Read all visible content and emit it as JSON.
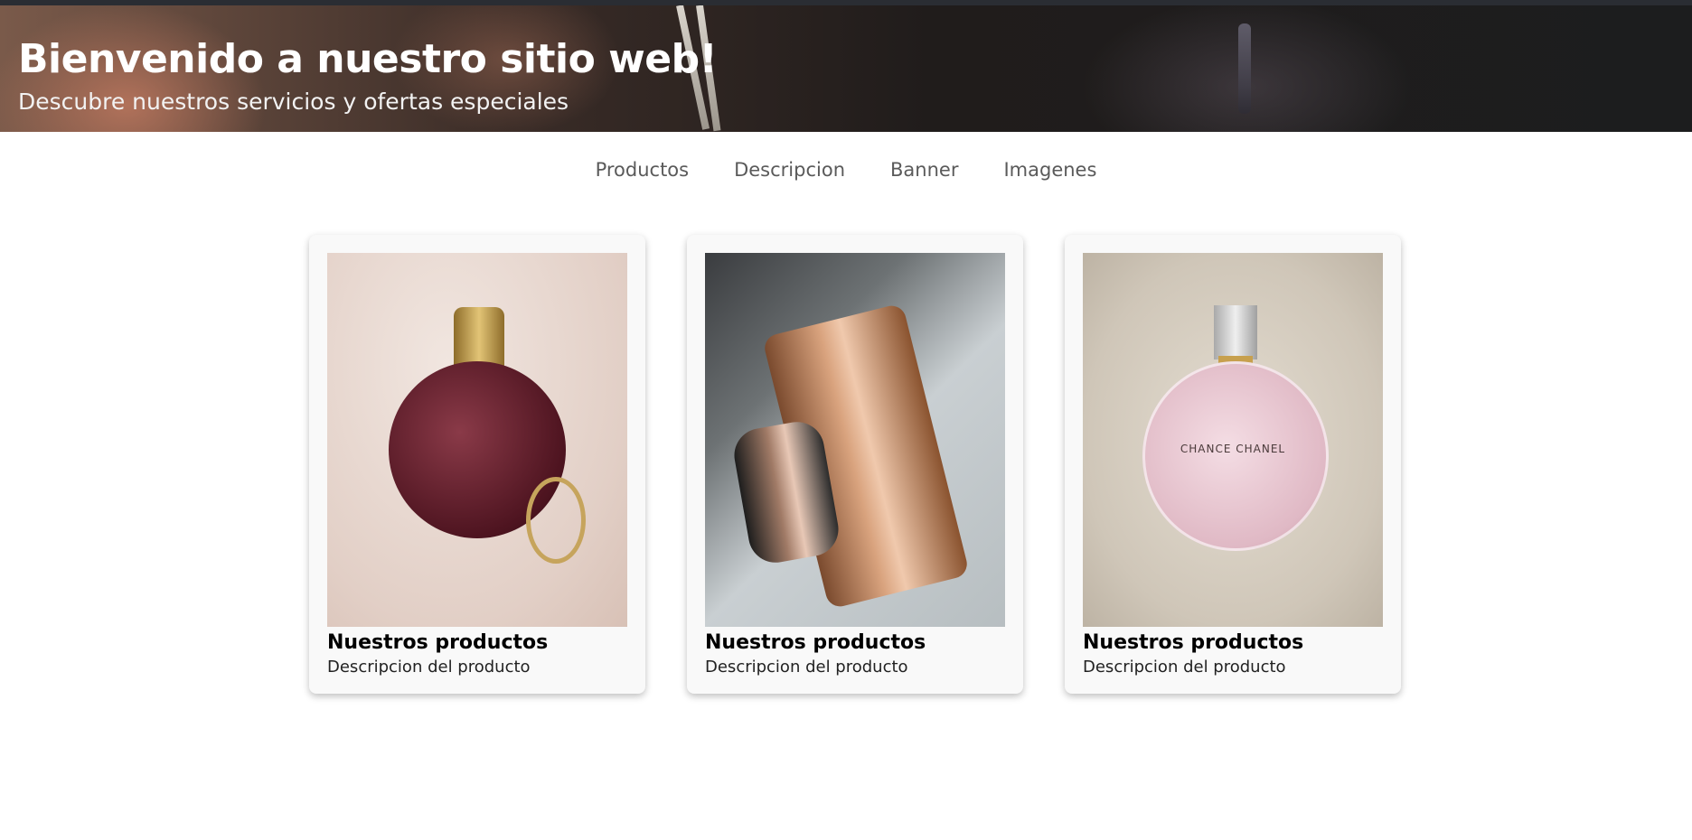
{
  "hero": {
    "title": "Bienvenido a nuestro sitio web!",
    "subtitle": "Descubre nuestros servicios y ofertas especiales"
  },
  "nav": {
    "items": [
      {
        "label": "Productos"
      },
      {
        "label": "Descripcion"
      },
      {
        "label": "Banner"
      },
      {
        "label": "Imagenes"
      }
    ]
  },
  "products": [
    {
      "title": "Nuestros productos",
      "description": "Descripcion del producto",
      "image_alt": "antique-perfume-flask"
    },
    {
      "title": "Nuestros productos",
      "description": "Descripcion del producto",
      "image_alt": "dark-perfume-bottle"
    },
    {
      "title": "Nuestros productos",
      "description": "Descripcion del producto",
      "image_alt": "pink-perfume-bottle",
      "image_text": "CHANCE CHANEL"
    }
  ]
}
